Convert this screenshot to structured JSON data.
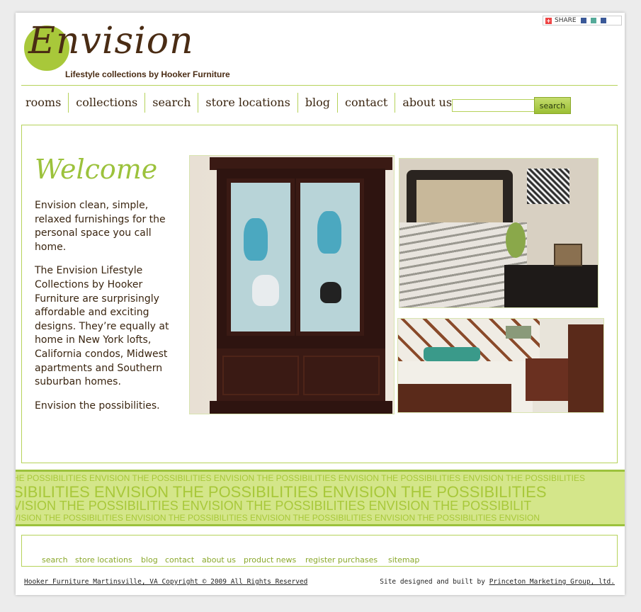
{
  "share": {
    "label": "SHARE"
  },
  "logo": {
    "word": "Envision",
    "tagline": "Lifestyle collections by Hooker Furniture"
  },
  "nav": {
    "items": [
      "rooms",
      "collections",
      "search",
      "store locations",
      "blog",
      "contact",
      "about us"
    ]
  },
  "search": {
    "button": "search",
    "value": ""
  },
  "main": {
    "title": "Welcome",
    "paragraphs": [
      "Envision clean, simple, relaxed furnishings for the personal space you call home.",
      "The Envision Lifestyle Collections by Hooker Furniture are surprisingly affordable and exciting designs. They’re equally at home in New York lofts, California condos, Midwest apartments and Southern suburban homes.",
      "Envision the possibilities."
    ]
  },
  "banner": {
    "line1": "HE POSSIBILITIES ENVISION THE POSSIBILITIES ENVISION THE POSSIBILITIES ENVISION THE POSSIBILITIES  ENVISION THE POSSIBILITIES",
    "line2": "SIBILITIES ENVISION THE POSSIBILITIES ENVISION THE POSSIBILITIES",
    "line3": "VISION THE POSSIBILITIES ENVISION THE POSSIBILITIES ENVISION THE POSSIBILIT",
    "line4": "VISION THE POSSIBILITIES ENVISION THE POSSIBILITIES ENVISION THE POSSIBILITIES ENVISION THE POSSIBILITIES ENVISION"
  },
  "footer": {
    "links": [
      "search",
      "store locations",
      "blog",
      "contact",
      "about us",
      "product news",
      "register purchases",
      "sitemap"
    ],
    "copyright": "Hooker Furniture Martinsville, VA Copyright © 2009 All Rights Reserved",
    "credit_prefix": "Site designed and built by ",
    "credit_link": "Princeton Marketing Group, ltd."
  },
  "colors": {
    "accent": "#9cc23c",
    "brown": "#3a2510"
  }
}
